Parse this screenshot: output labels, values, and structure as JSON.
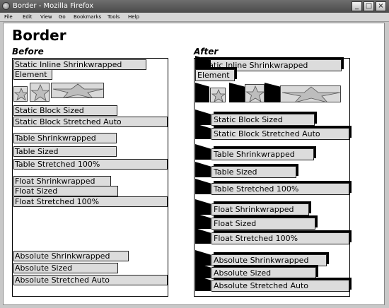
{
  "window": {
    "title": "Border - Mozilla Firefox",
    "buttons": {
      "minimize": "_",
      "maximize": "□",
      "close": "×"
    }
  },
  "menubar": [
    "File",
    "Edit",
    "View",
    "Go",
    "Bookmarks",
    "Tools",
    "Help"
  ],
  "page": {
    "title": "Border",
    "before_heading": "Before",
    "after_heading": "After"
  },
  "before": {
    "inline_line1": "Static Inline Shrinkwrapped",
    "inline_line2": "Element",
    "block_sized": "Static Block Sized",
    "block_stretched": "Static Block Stretched Auto",
    "table_shrink": "Table Shrinkwrapped",
    "table_sized": "Table Sized",
    "table_stretched": "Table Stretched 100%",
    "float_shrink": "Float Shrinkwrapped",
    "float_sized": "Float Sized",
    "float_stretched": "Float Stretched 100%",
    "abs_shrink": "Absolute Shrinkwrapped",
    "abs_sized": "Absolute Sized",
    "abs_stretched": "Absolute Stretched Auto"
  },
  "after": {
    "inline_line1": "Static Inline Shrinkwrapped",
    "inline_line2": "Element",
    "block_sized": "Static Block Sized",
    "block_stretched": "Static Block Stretched Auto",
    "table_shrink": "Table Shrinkwrapped",
    "table_sized": "Table Sized",
    "table_stretched": "Table Stretched 100%",
    "float_shrink": "Float Shrinkwrapped",
    "float_sized": "Float Sized",
    "float_stretched": "Float Stretched 100%",
    "abs_shrink": "Absolute Shrinkwrapped",
    "abs_sized": "Absolute Sized",
    "abs_stretched": "Absolute Stretched Auto"
  },
  "colors": {
    "item_bg": "#dcdcdc",
    "border": "#222222",
    "titlebar": "#5a5a5a"
  }
}
